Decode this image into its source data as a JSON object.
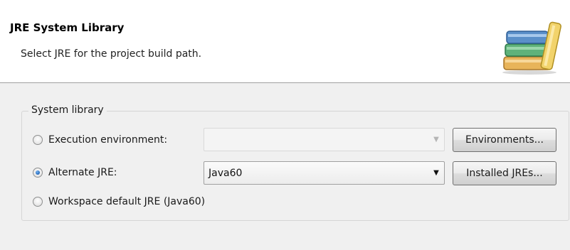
{
  "header": {
    "title": "JRE System Library",
    "description": "Select JRE for the project build path."
  },
  "system_library": {
    "legend": "System library",
    "options": [
      {
        "label": "Execution environment:",
        "checked": false,
        "combo_value": "",
        "combo_enabled": false,
        "button": "Environments..."
      },
      {
        "label": "Alternate JRE:",
        "checked": true,
        "combo_value": "Java60",
        "combo_enabled": true,
        "button": "Installed JREs..."
      },
      {
        "label": "Workspace default JRE (Java60)",
        "checked": false
      }
    ]
  },
  "icons": {
    "banner": "books-library-icon",
    "dropdown": "chevron-down-icon"
  },
  "colors": {
    "selected_radio": "#2a6fc2",
    "header_bg": "#ffffff",
    "body_bg": "#f0f0f0"
  }
}
